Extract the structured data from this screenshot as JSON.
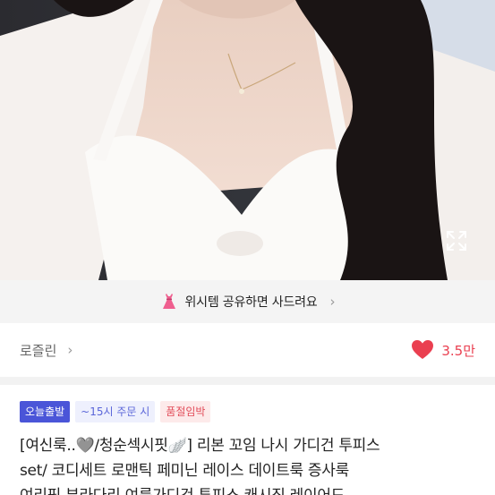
{
  "product_image": {
    "expand_icon": "expand-arrows-icon"
  },
  "wish_banner": {
    "icon": "dress-icon",
    "text": "위시템 공유하면 사드려요",
    "chevron": "›"
  },
  "seller": {
    "name": "로즐린",
    "chevron": "›"
  },
  "likes": {
    "icon": "heart-icon",
    "count": "3.5만",
    "color": "#ea3f50"
  },
  "badges": {
    "today": "오늘출발",
    "order_cutoff": "~15시 주문 시",
    "low_stock": "품절임박"
  },
  "title": {
    "line1": "[여신룩..🩶/청순섹시핏🪽] 리본 꼬임 나시 가디건 투피스",
    "line2": "set/ 코디세트 로맨틱 페미닌 레이스 데이트룩 증사룩",
    "line3": "여리핏 부라다리 여름가디건 투피스 캐시직 레이어드"
  }
}
